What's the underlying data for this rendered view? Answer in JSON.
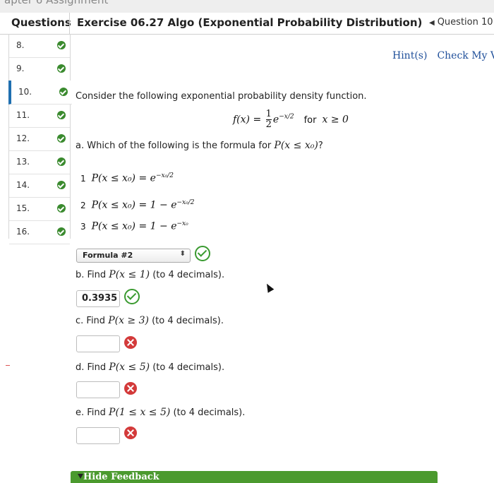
{
  "top_strip_text": "apter 6 Assignment",
  "header": {
    "questions_label": "Questions",
    "exercise_title": "Exercise 06.27 Algo (Exponential Probability Distribution)",
    "question_nav": "Question 10"
  },
  "sidebar": {
    "items": [
      {
        "num": "8.",
        "status": "answered"
      },
      {
        "num": "9.",
        "status": "answered"
      },
      {
        "num": "10.",
        "status": "current"
      },
      {
        "num": "11.",
        "status": "answered"
      },
      {
        "num": "12.",
        "status": "answered"
      },
      {
        "num": "13.",
        "status": "answered"
      },
      {
        "num": "14.",
        "status": "answered"
      },
      {
        "num": "15.",
        "status": "answered"
      },
      {
        "num": "16.",
        "status": "answered"
      }
    ]
  },
  "links": {
    "hints": "Hint(s)",
    "check": "Check My V"
  },
  "problem": {
    "intro": "Consider the following exponential probability density function.",
    "pdf_lhs": "f(x) = ",
    "pdf_num": "1",
    "pdf_den": "2",
    "pdf_e": "e",
    "pdf_exp": "−x/2",
    "pdf_for": "for",
    "pdf_domain": "x ≥ 0",
    "part_a_prefix": "a. Which of the following is the formula for ",
    "part_a_math": "P(x ≤ x₀)",
    "part_a_suffix": "?",
    "options": [
      {
        "n": "1",
        "expr": "P(x ≤ x₀) = e",
        "exp": "−x₀/2"
      },
      {
        "n": "2",
        "expr": "P(x ≤ x₀) = 1 − e",
        "exp": "−x₀/2"
      },
      {
        "n": "3",
        "expr": "P(x ≤ x₀) = 1 − e",
        "exp": "−x₀"
      }
    ],
    "select_value": "Formula #2",
    "part_b_prefix": "b. Find ",
    "part_b_math": "P(x ≤ 1)",
    "part_b_suffix": " (to 4 decimals).",
    "part_b_answer": "0.3935",
    "part_c_prefix": "c. Find ",
    "part_c_math": "P(x ≥ 3)",
    "part_c_suffix": " (to 4 decimals).",
    "part_c_answer": "",
    "part_d_prefix": "d. Find ",
    "part_d_math": "P(x ≤ 5)",
    "part_d_suffix": " (to 4 decimals).",
    "part_d_answer": "",
    "part_e_prefix": "e. Find ",
    "part_e_math": "P(1 ≤ x ≤ 5)",
    "part_e_suffix": " (to 4 decimals).",
    "part_e_answer": ""
  },
  "feedback": {
    "label": "Hide Feedback"
  },
  "colors": {
    "correct": "#3a9a30",
    "incorrect": "#d33a3a",
    "link": "#1f4f9a",
    "active_bar": "#1f6fb0",
    "feedback_bar": "#4b9a2e"
  }
}
